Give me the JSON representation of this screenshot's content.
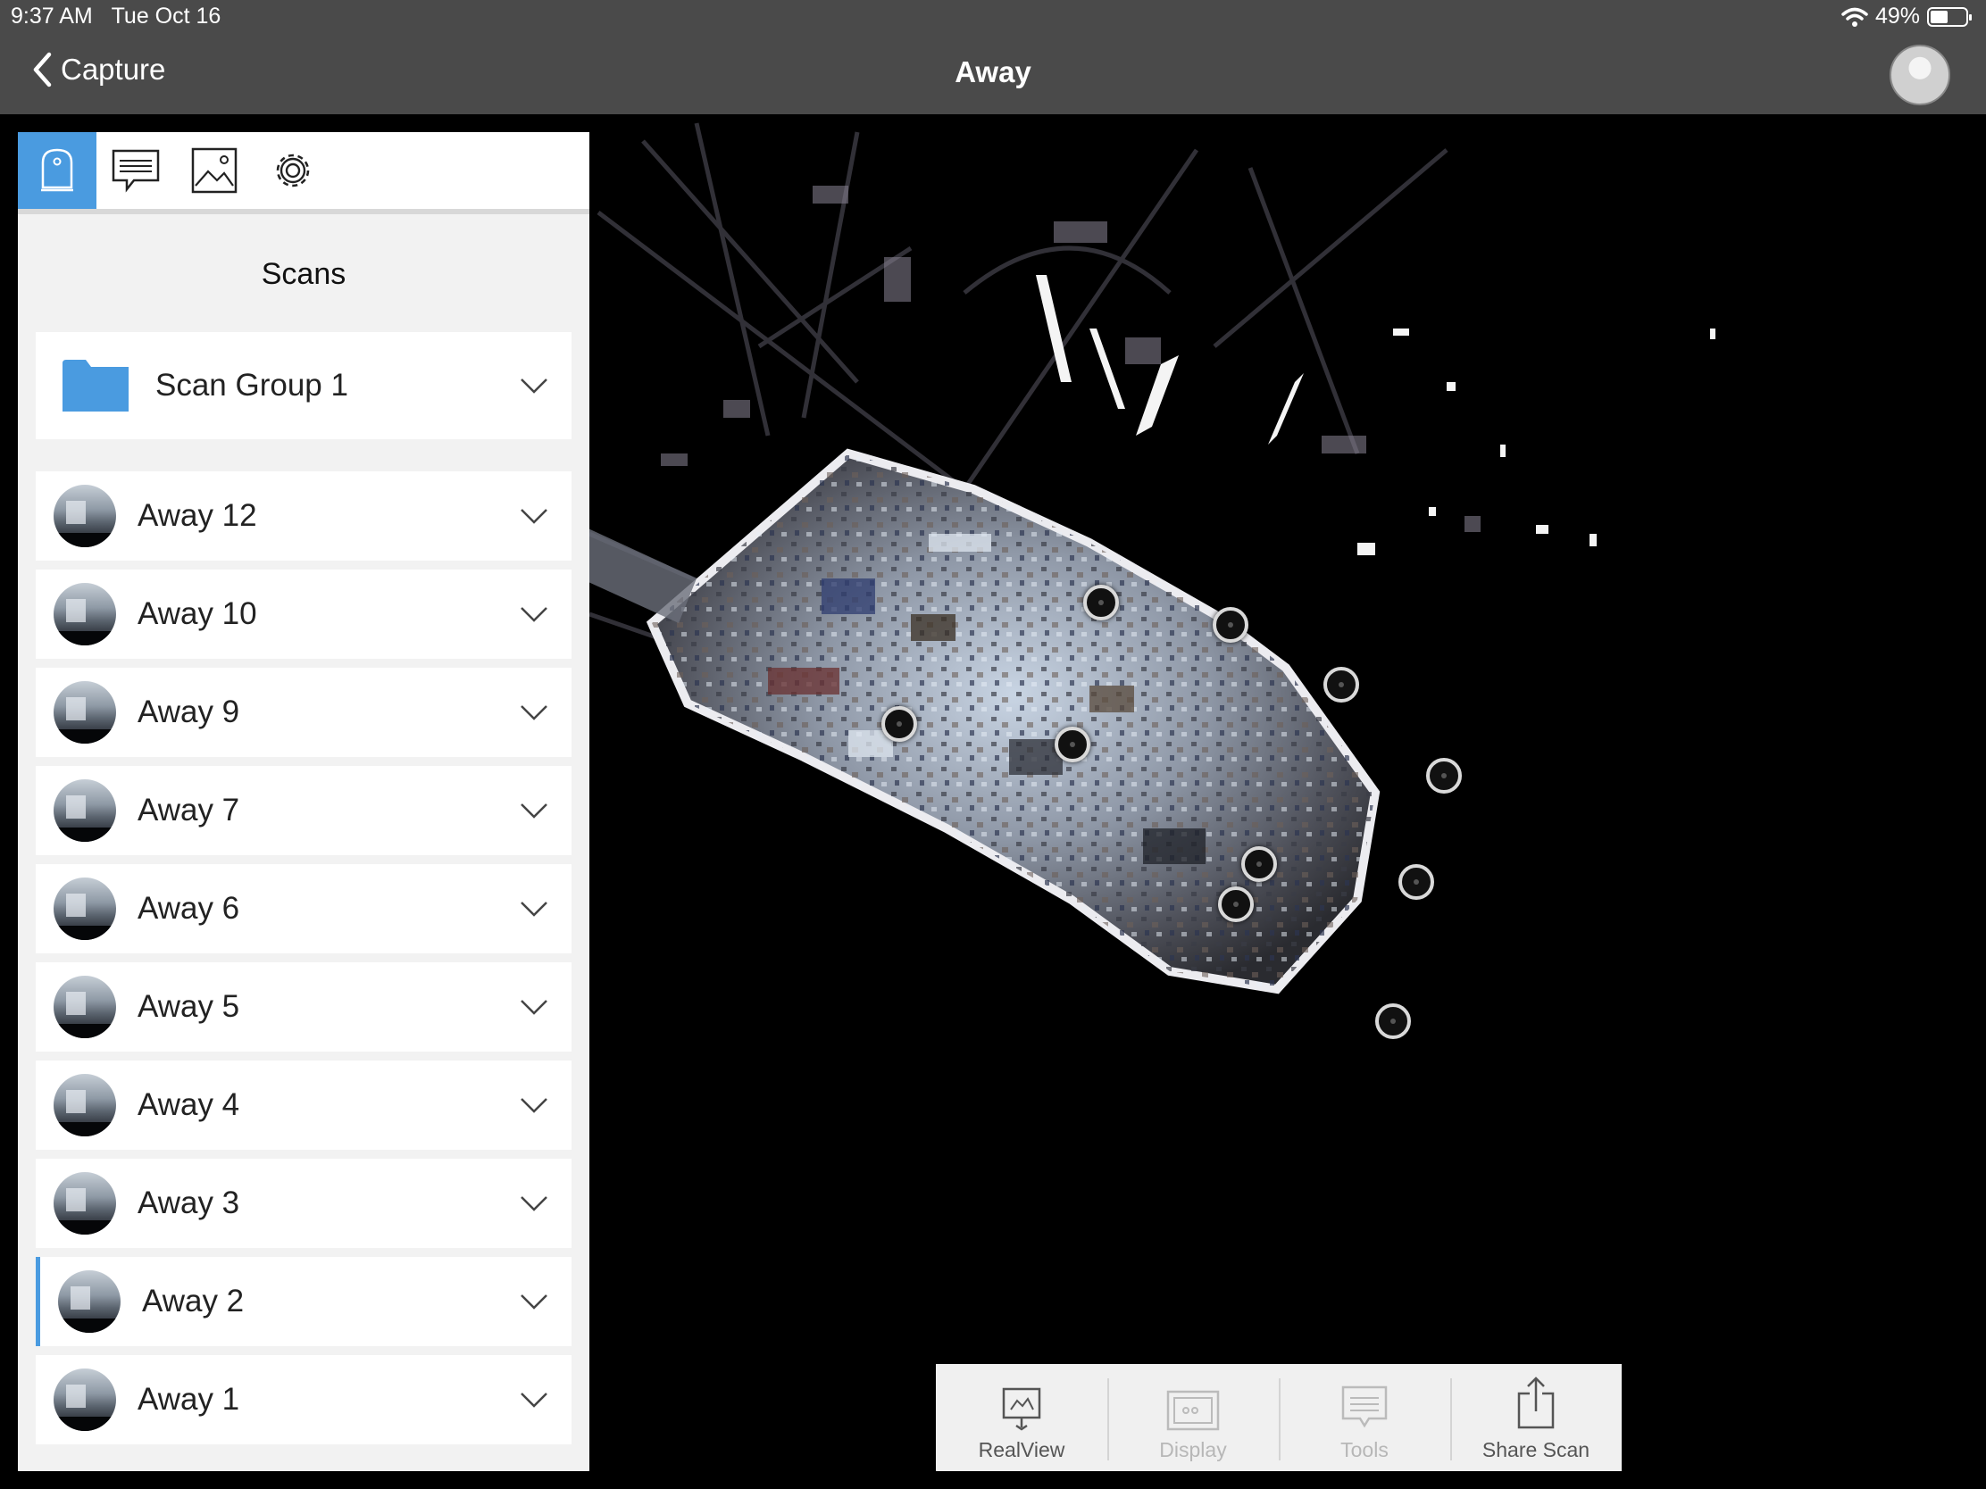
{
  "status": {
    "time": "9:37 AM",
    "date": "Tue Oct 16",
    "battery": "49%",
    "battery_level": 0.49
  },
  "nav": {
    "back_label": "Capture",
    "title": "Away"
  },
  "panel": {
    "title": "Scans",
    "group": {
      "label": "Scan Group 1"
    },
    "scans": [
      {
        "label": "Away 12",
        "selected": false
      },
      {
        "label": "Away 10",
        "selected": false
      },
      {
        "label": "Away 9",
        "selected": false
      },
      {
        "label": "Away 7",
        "selected": false
      },
      {
        "label": "Away 6",
        "selected": false
      },
      {
        "label": "Away 5",
        "selected": false
      },
      {
        "label": "Away 4",
        "selected": false
      },
      {
        "label": "Away 3",
        "selected": false
      },
      {
        "label": "Away 2",
        "selected": true
      },
      {
        "label": "Away 1",
        "selected": false
      }
    ]
  },
  "toolbar": {
    "realview": "RealView",
    "display": "Display",
    "tools": "Tools",
    "share": "Share Scan"
  },
  "colors": {
    "accent": "#4a9be0",
    "navbar": "#4a4a4a",
    "folder": "#4a9be0"
  }
}
